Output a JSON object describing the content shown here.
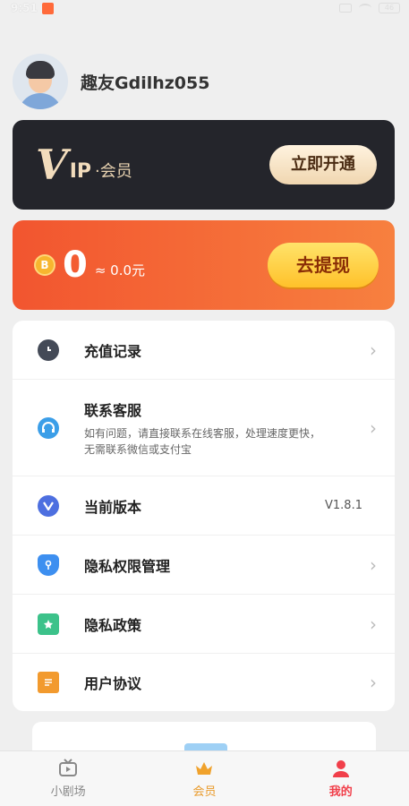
{
  "status_bar": {
    "time": "9:51",
    "battery": "46"
  },
  "profile": {
    "username": "趣友Gdilhz055"
  },
  "vip_card": {
    "logo_v": "V",
    "logo_ip": "IP",
    "logo_member": "·会员",
    "button": "立即开通"
  },
  "coin_card": {
    "coin_symbol": "B",
    "amount": "0",
    "approx": "≈ 0.0元",
    "button": "去提现"
  },
  "menu": {
    "items": [
      {
        "label": "充值记录",
        "icon": "clock-icon"
      },
      {
        "label": "联系客服",
        "icon": "headset-icon",
        "desc": "如有问题，请直接联系在线客服，处理速度更快，无需联系微信或支付宝"
      },
      {
        "label": "当前版本",
        "icon": "v-icon",
        "value": "V1.8.1"
      },
      {
        "label": "隐私权限管理",
        "icon": "shield-icon"
      },
      {
        "label": "隐私政策",
        "icon": "bookmark-icon"
      },
      {
        "label": "用户协议",
        "icon": "document-icon"
      }
    ]
  },
  "bottom_nav": {
    "items": [
      {
        "label": "小剧场",
        "icon": "tv-icon"
      },
      {
        "label": "会员",
        "icon": "crown-icon"
      },
      {
        "label": "我的",
        "icon": "person-icon"
      }
    ],
    "active": "我的"
  },
  "colors": {
    "vip_card_bg": "#24252b",
    "coin_card_gradient": [
      "#f2552f",
      "#f7803f"
    ],
    "withdraw_button": "#ffc12a",
    "active_tab": "#f13f4a"
  }
}
